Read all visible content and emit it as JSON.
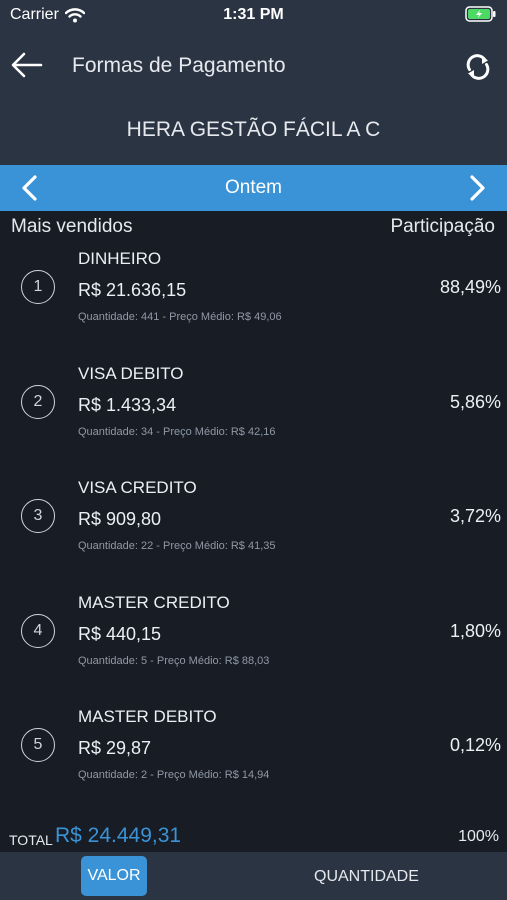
{
  "status_bar": {
    "carrier": "Carrier",
    "time": "1:31 PM"
  },
  "header": {
    "title": "Formas de Pagamento",
    "store": "HERA GESTÃO FÁCIL A C"
  },
  "date_nav": {
    "label": "Ontem"
  },
  "list_header": {
    "left": "Mais vendidos",
    "right": "Participação"
  },
  "items": [
    {
      "rank": "1",
      "name": "DINHEIRO",
      "value": "R$ 21.636,15",
      "detail": "Quantidade: 441 - Preço Médio: R$ 49,06",
      "share": "88,49%"
    },
    {
      "rank": "2",
      "name": "VISA DEBITO",
      "value": "R$ 1.433,34",
      "detail": "Quantidade: 34 - Preço Médio: R$ 42,16",
      "share": "5,86%"
    },
    {
      "rank": "3",
      "name": "VISA CREDITO",
      "value": "R$ 909,80",
      "detail": "Quantidade: 22 - Preço Médio: R$ 41,35",
      "share": "3,72%"
    },
    {
      "rank": "4",
      "name": "MASTER CREDITO",
      "value": "R$ 440,15",
      "detail": "Quantidade: 5 - Preço Médio: R$ 88,03",
      "share": "1,80%"
    },
    {
      "rank": "5",
      "name": "MASTER DEBITO",
      "value": "R$ 29,87",
      "detail": "Quantidade: 2 - Preço Médio: R$ 14,94",
      "share": "0,12%"
    }
  ],
  "total": {
    "label": "TOTAL",
    "amount": "R$ 24.449,31",
    "share": "100%"
  },
  "tabs": {
    "valor": "VALOR",
    "quantidade": "QUANTIDADE"
  },
  "colors": {
    "accent": "#3a93d6",
    "background": "#181d25",
    "bar": "#2b3442"
  },
  "icons": [
    "wifi-icon",
    "battery-icon",
    "back-arrow-icon",
    "refresh-icon",
    "chevron-left-icon",
    "chevron-right-icon"
  ]
}
